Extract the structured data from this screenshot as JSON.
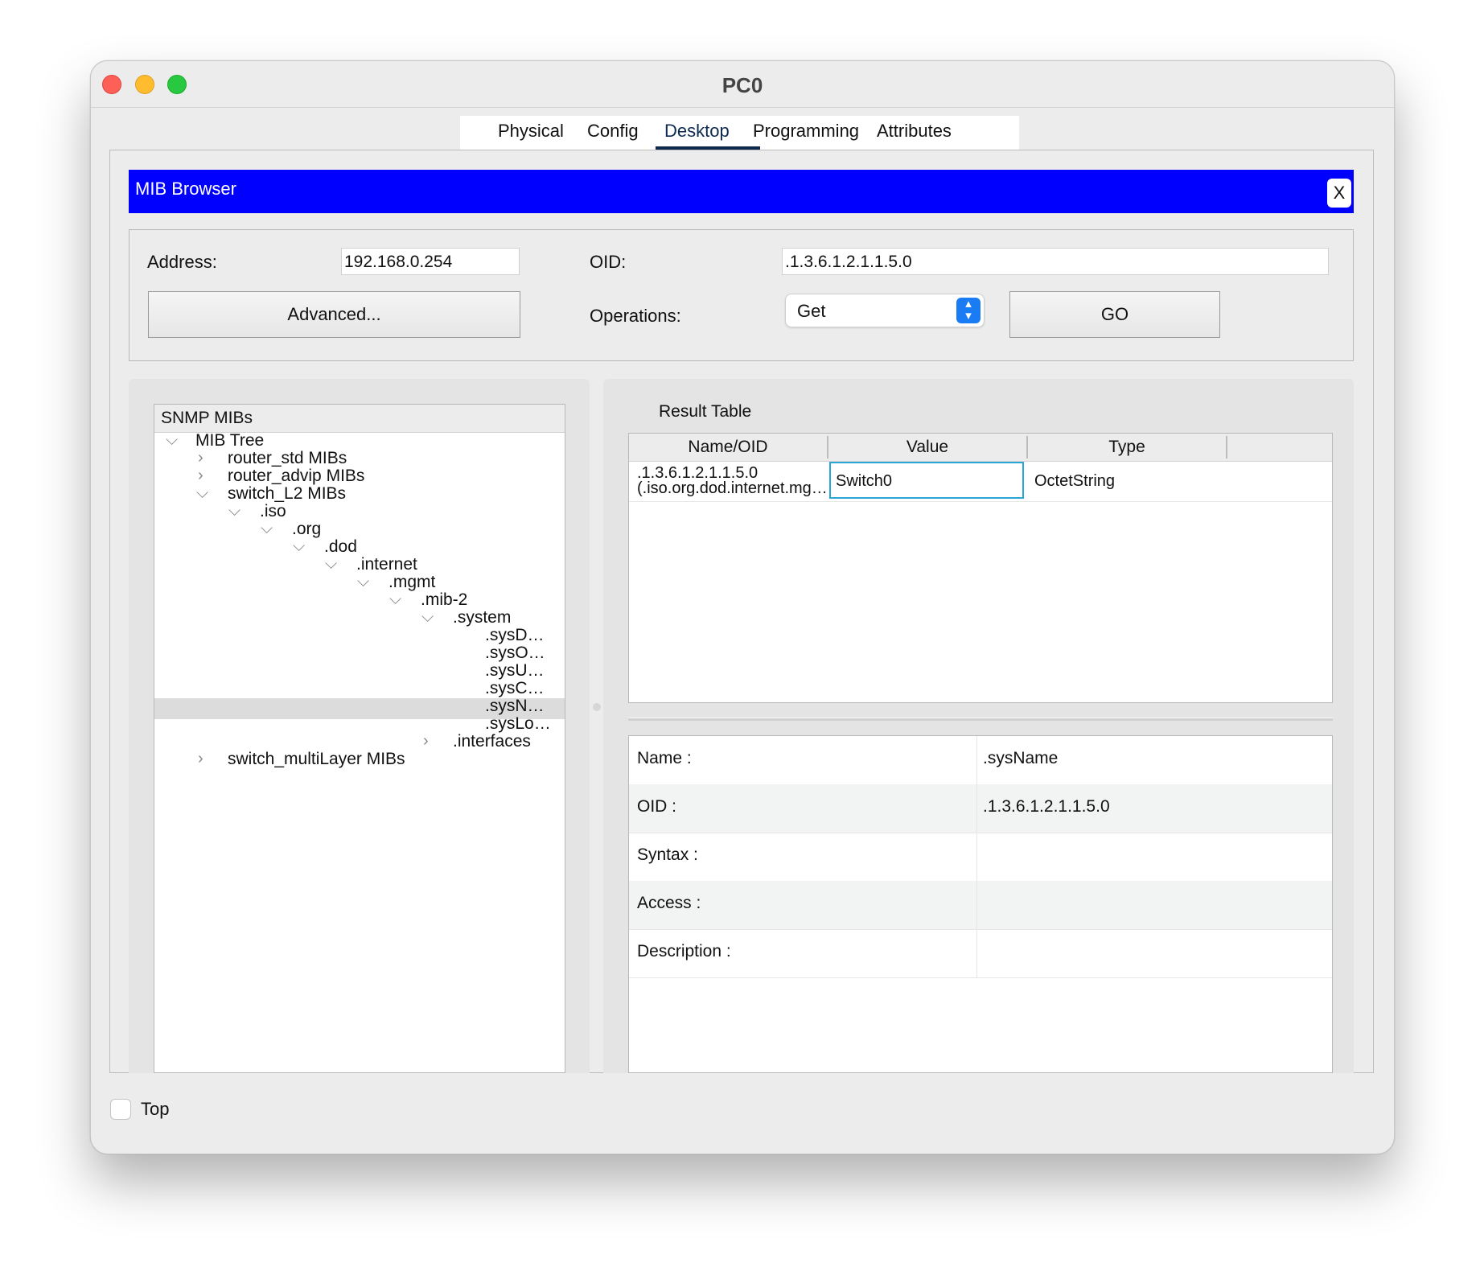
{
  "window": {
    "title": "PC0"
  },
  "tabs": [
    "Physical",
    "Config",
    "Desktop",
    "Programming",
    "Attributes"
  ],
  "active_tab": "Desktop",
  "mib_browser": {
    "title": "MIB Browser",
    "close_label": "X",
    "address_label": "Address:",
    "address_value": "192.168.0.254",
    "oid_label": "OID:",
    "oid_value": ".1.3.6.1.2.1.1.5.0",
    "advanced_label": "Advanced...",
    "operations_label": "Operations:",
    "operation_selected": "Get",
    "go_label": "GO"
  },
  "tree": {
    "header": "SNMP MIBs",
    "nodes": {
      "mib_tree": "MIB Tree",
      "router_std": "router_std MIBs",
      "router_advip": "router_advip MIBs",
      "switch_l2": "switch_L2 MIBs",
      "iso": ".iso",
      "org": ".org",
      "dod": ".dod",
      "internet": ".internet",
      "mgmt": ".mgmt",
      "mib2": ".mib-2",
      "system": ".system",
      "sysd": ".sysD…",
      "syso": ".sysO…",
      "sysu": ".sysU…",
      "sysc": ".sysC…",
      "sysn": ".sysN…",
      "syslo": ".sysLo…",
      "interfaces": ".interfaces",
      "switch_multilayer": "switch_multiLayer MIBs"
    },
    "selected": ".sysN…"
  },
  "result_table": {
    "title": "Result Table",
    "columns": [
      "Name/OID",
      "Value",
      "Type"
    ],
    "rows": [
      {
        "oid": ".1.3.6.1.2.1.1.5.0",
        "name": "(.iso.org.dod.internet.mg…",
        "value": "Switch0",
        "type": "OctetString"
      }
    ]
  },
  "details": [
    {
      "key": "Name :",
      "value": ".sysName"
    },
    {
      "key": "OID :",
      "value": ".1.3.6.1.2.1.1.5.0"
    },
    {
      "key": "Syntax :",
      "value": ""
    },
    {
      "key": "Access :",
      "value": ""
    },
    {
      "key": "Description :",
      "value": ""
    }
  ],
  "footer": {
    "top_label": "Top",
    "top_checked": false
  },
  "colors": {
    "mib_bar": "#0000ff",
    "tab_underline": "#0d2a4e",
    "select_accent": "#1a7cf5",
    "value_cell_border": "#2aa5d4"
  }
}
